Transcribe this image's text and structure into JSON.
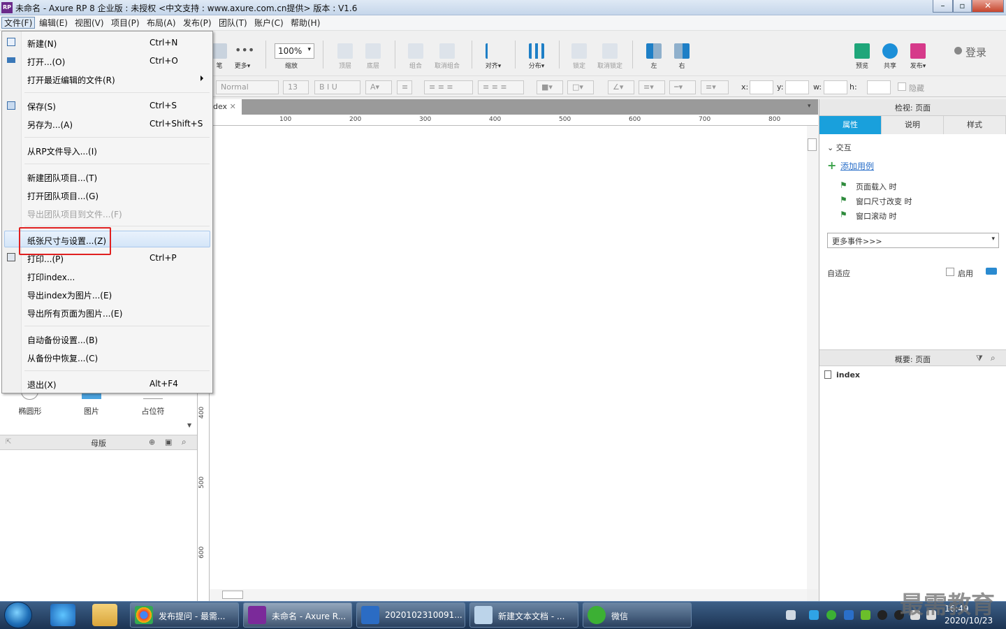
{
  "window": {
    "title": "未命名 - Axure RP 8 企业版 : 未授权      <中文支持 : www.axure.com.cn提供> 版本 : V1.6",
    "icon_text": "RP"
  },
  "menubar": {
    "items": [
      "文件(F)",
      "编辑(E)",
      "视图(V)",
      "项目(P)",
      "布局(A)",
      "发布(P)",
      "团队(T)",
      "账户(C)",
      "帮助(H)"
    ]
  },
  "toolbar": {
    "left_partial": [
      "笔",
      "更多▾"
    ],
    "zoom_value": "100%",
    "zoom_label": "缩放",
    "buttons": [
      "顶层",
      "底层",
      "组合",
      "取消组合",
      "对齐▾",
      "分布▾",
      "锁定",
      "取消锁定",
      "左",
      "右"
    ],
    "right_buttons": [
      "预览",
      "共享",
      "发布▾"
    ],
    "login": "登录"
  },
  "formatbar": {
    "style": "Normal",
    "font_size": "13",
    "x_label": "x:",
    "y_label": "y:",
    "w_label": "w:",
    "h_label": "h:",
    "hide_label": "隐藏"
  },
  "canvas": {
    "tab_label": "dex",
    "ruler_h": [
      "100",
      "200",
      "300",
      "400",
      "500",
      "600",
      "700",
      "800"
    ],
    "ruler_v": [
      "400",
      "500",
      "600"
    ]
  },
  "left_panel": {
    "library_items": [
      "椭圆形",
      "图片",
      "占位符"
    ],
    "masters_title": "母版"
  },
  "right_panel": {
    "inspect_title": "检视: 页面",
    "tabs": [
      "属性",
      "说明",
      "样式"
    ],
    "interaction_title": "交互",
    "add_case": "添加用例",
    "events": [
      "页面载入 时",
      "窗口尺寸改变 时",
      "窗口滚动 时"
    ],
    "more_events": "更多事件>>>",
    "adaptive": "自适应",
    "enable": "启用",
    "outline_title": "概要: 页面",
    "outline_page": "index"
  },
  "file_menu": {
    "items": [
      {
        "label": "新建(N)",
        "shortcut": "Ctrl+N"
      },
      {
        "label": "打开...(O)",
        "shortcut": "Ctrl+O"
      },
      {
        "label": "打开最近编辑的文件(R)",
        "shortcut": ""
      },
      {
        "label": "保存(S)",
        "shortcut": "Ctrl+S"
      },
      {
        "label": "另存为...(A)",
        "shortcut": "Ctrl+Shift+S"
      },
      {
        "label": "从RP文件导入...(I)",
        "shortcut": ""
      },
      {
        "label": "新建团队项目...(T)",
        "shortcut": ""
      },
      {
        "label": "打开团队项目...(G)",
        "shortcut": ""
      },
      {
        "label": "导出团队项目到文件...(F)",
        "shortcut": ""
      },
      {
        "label": "纸张尺寸与设置...(Z)",
        "shortcut": ""
      },
      {
        "label": "打印...(P)",
        "shortcut": "Ctrl+P"
      },
      {
        "label": "打印index...",
        "shortcut": ""
      },
      {
        "label": "导出index为图片...(E)",
        "shortcut": ""
      },
      {
        "label": "导出所有页面为图片...(E)",
        "shortcut": ""
      },
      {
        "label": "自动备份设置...(B)",
        "shortcut": ""
      },
      {
        "label": "从备份中恢复...(C)",
        "shortcut": ""
      },
      {
        "label": "退出(X)",
        "shortcut": "Alt+F4"
      }
    ]
  },
  "taskbar": {
    "tasks": [
      "发布提问 - 最需...",
      "未命名 - Axure R...",
      "2020102310091...",
      "新建文本文档 - ...",
      "微信"
    ],
    "time": "16:49",
    "date": "2020/10/23"
  },
  "watermark": "最需教育"
}
